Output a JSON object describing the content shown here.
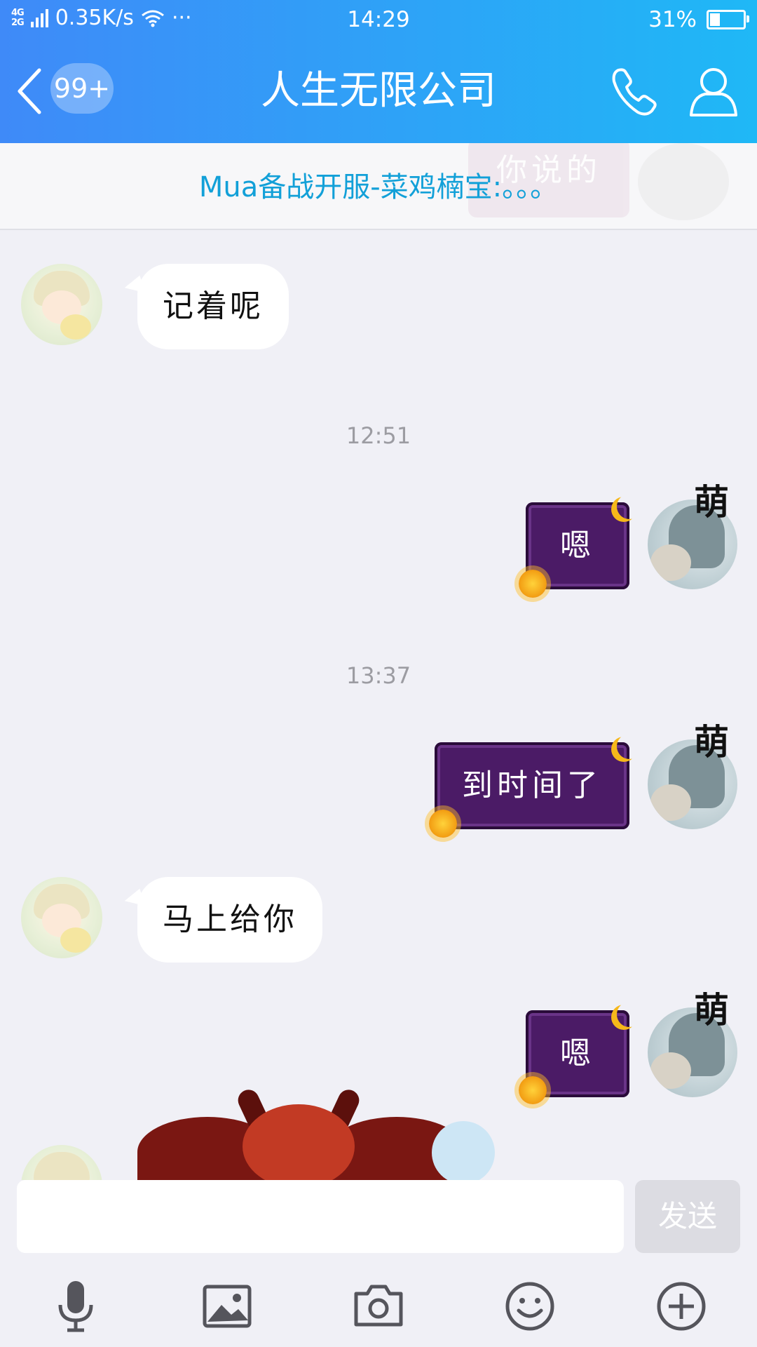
{
  "status_bar": {
    "network_type": "4G\n2G",
    "net_speed": "0.35K/s",
    "more": "···",
    "time": "14:29",
    "battery": "31%",
    "battery_level": 0.31
  },
  "nav": {
    "unread_badge": "99+",
    "title": "人生无限公司"
  },
  "notice": {
    "text": "Mua备战开服-菜鸡楠宝:。。。",
    "deco_text": "你说的"
  },
  "messages": {
    "m1": {
      "text": "记着呢"
    },
    "ts1": "12:51",
    "m2": {
      "text": "嗯",
      "nickname_badge": "萌"
    },
    "ts2": "13:37",
    "m3": {
      "text": "到时间了",
      "nickname_badge": "萌"
    },
    "m4": {
      "text": "马上给你"
    },
    "m5": {
      "text": "嗯",
      "nickname_badge": "萌"
    }
  },
  "input": {
    "value": "",
    "send_label": "发送"
  },
  "colors": {
    "header_start": "#3f8af8",
    "header_end": "#1fb8f6",
    "notice_text": "#12a0d8",
    "bubble_right": "#4b1b66",
    "background": "#f0f0f6"
  }
}
